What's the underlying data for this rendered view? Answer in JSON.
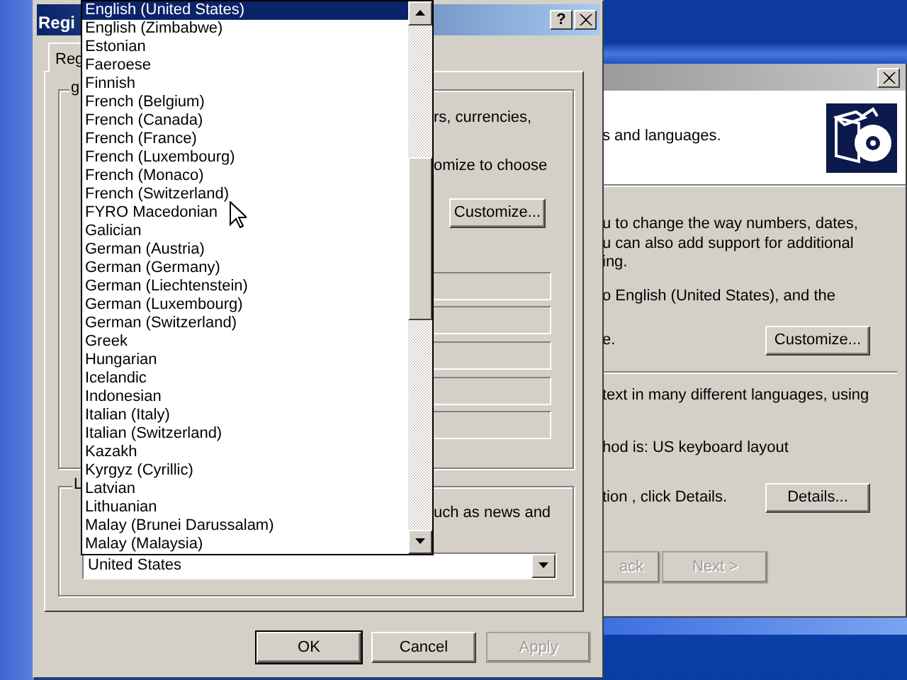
{
  "back_window": {
    "header_text": "s and languages.",
    "regional_lines": [
      "u to change the way numbers, dates,",
      "u can also add support for additional",
      "ing."
    ],
    "language_lines": [
      "o English (United States), and the",
      "e."
    ],
    "customize_button": "Customize...",
    "input_lines": [
      "text in many different languages, using",
      "hod is: US keyboard layout",
      "tion , click Details."
    ],
    "details_button": "Details...",
    "nav_buttons": [
      {
        "label": "ack",
        "disabled": true
      },
      {
        "label": "Next >",
        "disabled": true
      }
    ]
  },
  "dialog": {
    "title": "Regi",
    "help_button": "?",
    "tabs": [
      {
        "label": "Reg",
        "selected": true
      }
    ],
    "group_1": {
      "legend": "g",
      "lines": [
        "rs, currencies,",
        "omize to choose"
      ],
      "button": "Customize..."
    },
    "group_2": {
      "legend": "L",
      "line": "uch as news and",
      "location_value": "United States"
    },
    "buttons": [
      {
        "label": "OK",
        "disabled": false
      },
      {
        "label": "Cancel",
        "disabled": false
      },
      {
        "label": "Apply",
        "disabled": true
      }
    ]
  },
  "dropdown_list": [
    {
      "label": "English (United States)",
      "selected": true
    },
    {
      "label": "English (Zimbabwe)",
      "selected": false
    },
    {
      "label": "Estonian",
      "selected": false
    },
    {
      "label": "Faeroese",
      "selected": false
    },
    {
      "label": "Finnish",
      "selected": false
    },
    {
      "label": "French (Belgium)",
      "selected": false
    },
    {
      "label": "French (Canada)",
      "selected": false
    },
    {
      "label": "French (France)",
      "selected": false
    },
    {
      "label": "French (Luxembourg)",
      "selected": false
    },
    {
      "label": "French (Monaco)",
      "selected": false
    },
    {
      "label": "French (Switzerland)",
      "selected": false
    },
    {
      "label": "FYRO Macedonian",
      "selected": false
    },
    {
      "label": "Galician",
      "selected": false
    },
    {
      "label": "German (Austria)",
      "selected": false
    },
    {
      "label": "German (Germany)",
      "selected": false
    },
    {
      "label": "German (Liechtenstein)",
      "selected": false
    },
    {
      "label": "German (Luxembourg)",
      "selected": false
    },
    {
      "label": "German (Switzerland)",
      "selected": false
    },
    {
      "label": "Greek",
      "selected": false
    },
    {
      "label": "Hungarian",
      "selected": false
    },
    {
      "label": "Icelandic",
      "selected": false
    },
    {
      "label": "Indonesian",
      "selected": false
    },
    {
      "label": "Italian (Italy)",
      "selected": false
    },
    {
      "label": "Italian (Switzerland)",
      "selected": false
    },
    {
      "label": "Kazakh",
      "selected": false
    },
    {
      "label": "Kyrgyz (Cyrillic)",
      "selected": false
    },
    {
      "label": "Latvian",
      "selected": false
    },
    {
      "label": "Lithuanian",
      "selected": false
    },
    {
      "label": "Malay (Brunei Darussalam)",
      "selected": false
    },
    {
      "label": "Malay (Malaysia)",
      "selected": false
    }
  ]
}
